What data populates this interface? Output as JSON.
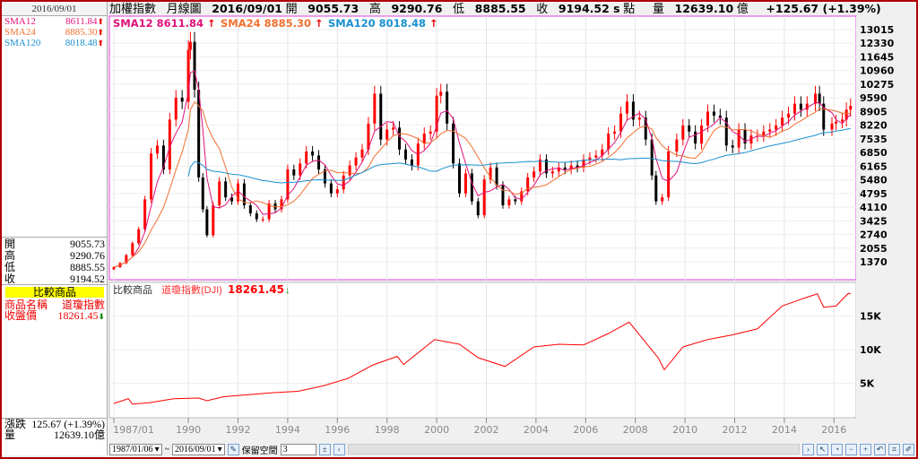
{
  "left": {
    "date": "2016/09/01",
    "sma": [
      {
        "label": "SMA12",
        "value": "8611.84",
        "color": "#e0107a"
      },
      {
        "label": "SMA24",
        "value": "8885.30",
        "color": "#f07030"
      },
      {
        "label": "SMA120",
        "value": "8018.48",
        "color": "#1890d0"
      }
    ],
    "ohlc": [
      {
        "label": "開",
        "value": "9055.73"
      },
      {
        "label": "高",
        "value": "9290.76"
      },
      {
        "label": "低",
        "value": "8885.55"
      },
      {
        "label": "收",
        "value": "9194.52"
      }
    ],
    "compare": {
      "title": "比較商品",
      "name_label": "商品名稱",
      "name_value": "道瓊指數",
      "close_label": "收盤價",
      "close_value": "18261.45"
    },
    "change": {
      "label": "漲跌",
      "value": "125.67 (+1.39%)",
      "vol_label": "量",
      "vol_value": "12639.10億"
    }
  },
  "header": {
    "title": "加權指數",
    "period": "月線圖",
    "date": "2016/09/01",
    "open_label": "開",
    "open": "9055.73",
    "high_label": "高",
    "high": "9290.76",
    "low_label": "低",
    "low": "8885.55",
    "close_label": "收",
    "close": "9194.52 s",
    "close_unit": "點",
    "vol_label": "量",
    "vol": "12639.10",
    "vol_unit": "億",
    "change": "+125.67 (+1.39%)"
  },
  "legend": [
    "SMA12 8611.84",
    "SMA24 8885.30",
    "SMA120 8018.48"
  ],
  "sub": {
    "label": "比較商品",
    "series": "道瓊指數(DJI)",
    "value": "18261.45"
  },
  "toolbar": {
    "from": "1987/01/06",
    "tilde": "~",
    "to": "2016/09/01",
    "keep_label": "保留空間",
    "keep_value": "3"
  },
  "icons": [
    "up-arrow-icon",
    "down-arrow-icon",
    "pointer-icon",
    "clock-icon",
    "zoom-out-icon",
    "zoom-in-icon",
    "undo-icon",
    "fit-icon",
    "settings-icon"
  ],
  "chart_data": [
    {
      "type": "candlestick",
      "title": "加權指數 月線圖",
      "colors": {
        "up": "#ff0000",
        "down": "#000000",
        "sma12": "#e0107a",
        "sma24": "#f07030",
        "sma120": "#1890d0"
      },
      "yticks": [
        13015,
        12330,
        11645,
        10960,
        10275,
        9590,
        8905,
        8220,
        7535,
        6850,
        6165,
        5480,
        4795,
        4110,
        3425,
        2740,
        2055,
        1370
      ],
      "ylim": [
        470,
        13690
      ],
      "xticks": [
        "1987/01",
        "1990",
        "1992",
        "1994",
        "1996",
        "1998",
        "2000",
        "2002",
        "2004",
        "2006",
        "2008",
        "2010",
        "2012",
        "2014",
        "2016"
      ],
      "dates": [
        "1987/01",
        "1987/04",
        "1987/07",
        "1987/10",
        "1988/01",
        "1988/04",
        "1988/07",
        "1988/10",
        "1989/01",
        "1989/04",
        "1989/07",
        "1989/10",
        "1990/01",
        "1990/02",
        "1990/04",
        "1990/06",
        "1990/08",
        "1990/10",
        "1991/01",
        "1991/04",
        "1991/07",
        "1991/10",
        "1992/01",
        "1992/04",
        "1992/07",
        "1992/10",
        "1993/01",
        "1993/04",
        "1993/07",
        "1993/10",
        "1994/01",
        "1994/04",
        "1994/07",
        "1994/10",
        "1995/01",
        "1995/04",
        "1995/07",
        "1995/10",
        "1996/01",
        "1996/04",
        "1996/07",
        "1996/10",
        "1997/01",
        "1997/04",
        "1997/07",
        "1997/10",
        "1998/01",
        "1998/04",
        "1998/07",
        "1998/10",
        "1999/01",
        "1999/04",
        "1999/07",
        "1999/10",
        "2000/01",
        "2000/03",
        "2000/06",
        "2000/09",
        "2000/12",
        "2001/03",
        "2001/06",
        "2001/09",
        "2001/12",
        "2002/03",
        "2002/06",
        "2002/09",
        "2002/12",
        "2003/03",
        "2003/06",
        "2003/09",
        "2003/12",
        "2004/03",
        "2004/06",
        "2004/09",
        "2004/12",
        "2005/03",
        "2005/06",
        "2005/09",
        "2005/12",
        "2006/03",
        "2006/06",
        "2006/09",
        "2006/12",
        "2007/03",
        "2007/06",
        "2007/09",
        "2007/12",
        "2008/03",
        "2008/06",
        "2008/09",
        "2008/11",
        "2009/02",
        "2009/05",
        "2009/09",
        "2009/12",
        "2010/03",
        "2010/06",
        "2010/09",
        "2010/12",
        "2011/03",
        "2011/06",
        "2011/09",
        "2011/12",
        "2012/03",
        "2012/06",
        "2012/09",
        "2012/12",
        "2013/03",
        "2013/06",
        "2013/09",
        "2013/12",
        "2014/03",
        "2014/06",
        "2014/09",
        "2014/12",
        "2015/04",
        "2015/06",
        "2015/08",
        "2015/12",
        "2016/02",
        "2016/05",
        "2016/07",
        "2016/09"
      ],
      "close": [
        1100,
        1300,
        1700,
        2300,
        3000,
        4500,
        6800,
        7200,
        6000,
        8500,
        9600,
        9400,
        12000,
        12400,
        10000,
        5600,
        4000,
        2700,
        4200,
        5400,
        4600,
        4400,
        5300,
        4200,
        3800,
        3500,
        3500,
        4300,
        4000,
        4500,
        6000,
        5700,
        6300,
        6900,
        6700,
        6000,
        5300,
        4800,
        5000,
        5700,
        6200,
        6600,
        7000,
        8300,
        9800,
        7500,
        8000,
        8100,
        7000,
        6500,
        6200,
        7300,
        7800,
        7900,
        9700,
        9900,
        8300,
        6300,
        4800,
        5800,
        4400,
        3700,
        5500,
        6100,
        5200,
        4200,
        4500,
        4400,
        4900,
        5600,
        5900,
        6500,
        5800,
        5900,
        6100,
        6000,
        6200,
        6100,
        6500,
        6600,
        6700,
        7000,
        7800,
        7900,
        8800,
        9400,
        8500,
        8600,
        7500,
        5700,
        4400,
        4600,
        6900,
        7500,
        8200,
        7900,
        7300,
        8200,
        8900,
        8700,
        8600,
        7200,
        7100,
        8000,
        7300,
        7700,
        7700,
        7900,
        8000,
        8200,
        8600,
        8800,
        9300,
        9000,
        9300,
        9800,
        9300,
        8000,
        8300,
        8400,
        8500,
        9000,
        9194.52
      ]
    },
    {
      "type": "line",
      "series": [
        {
          "name": "道瓊指數(DJI)",
          "color": "#ff0000"
        }
      ],
      "yticks": [
        "15K",
        "10K",
        "5K"
      ],
      "ylim": [
        -130,
        20000
      ],
      "dates": [
        "1987/01",
        "1987/08",
        "1987/10",
        "1988/06",
        "1989/06",
        "1990/06",
        "1990/10",
        "1991/06",
        "1992/06",
        "1993/06",
        "1994/06",
        "1995/06",
        "1996/06",
        "1997/06",
        "1998/06",
        "1998/09",
        "1999/12",
        "2000/12",
        "2001/09",
        "2002/10",
        "2003/12",
        "2004/12",
        "2005/12",
        "2006/12",
        "2007/10",
        "2008/12",
        "2009/03",
        "2009/12",
        "2010/12",
        "2011/12",
        "2012/12",
        "2013/12",
        "2014/12",
        "2015/05",
        "2015/08",
        "2016/02",
        "2016/08",
        "2016/09"
      ],
      "values": [
        2000,
        2700,
        1900,
        2100,
        2700,
        2800,
        2400,
        3000,
        3300,
        3600,
        3800,
        4600,
        5700,
        7700,
        9000,
        7800,
        11500,
        10800,
        8800,
        7500,
        10400,
        10800,
        10700,
        12400,
        14100,
        8800,
        7000,
        10400,
        11500,
        12200,
        13100,
        16500,
        17800,
        18300,
        16300,
        16500,
        18400,
        18261.45
      ]
    }
  ]
}
